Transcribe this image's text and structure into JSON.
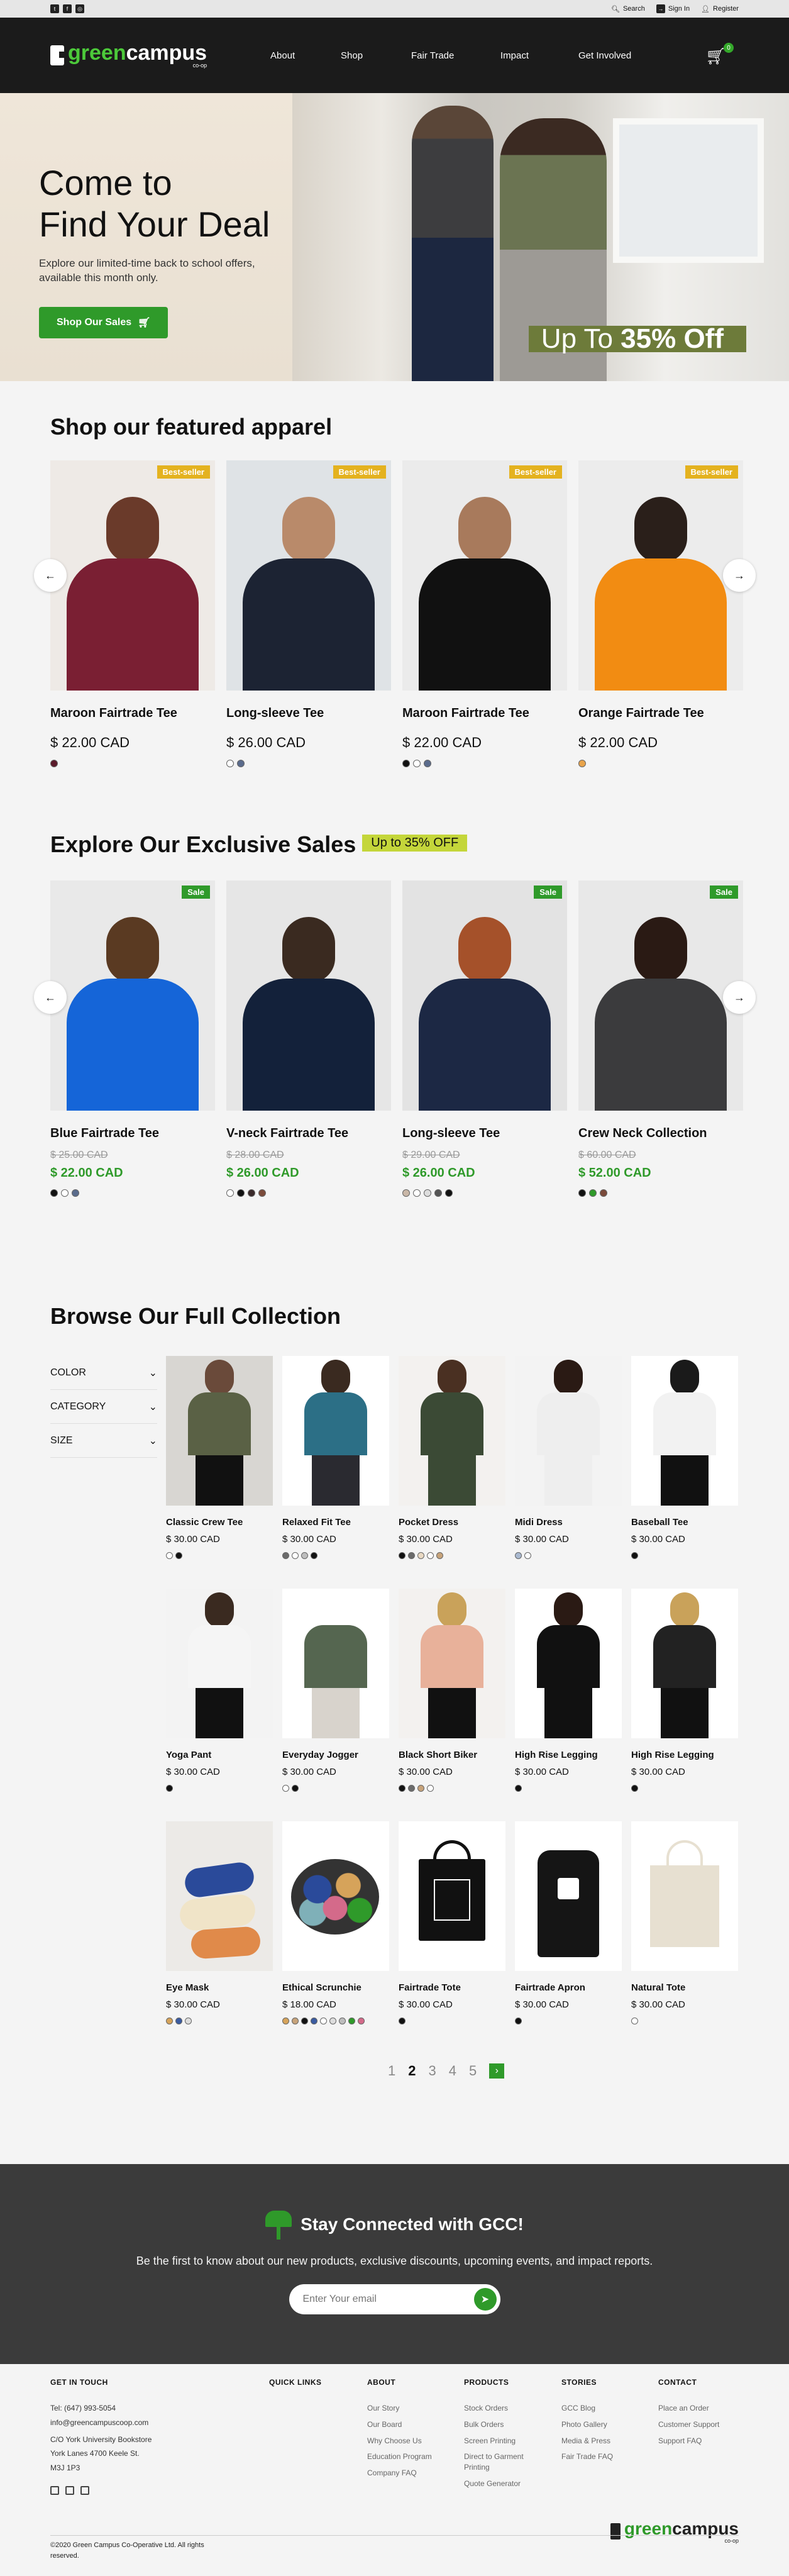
{
  "util": {
    "search": "Search",
    "signin": "Sign In",
    "register": "Register"
  },
  "brand": {
    "logo_green": "green",
    "logo_rest": "campus",
    "logo_sub": "co-op"
  },
  "nav": [
    "About",
    "Shop",
    "Fair Trade",
    "Impact",
    "Get Involved"
  ],
  "cart_count": "0",
  "hero": {
    "title_line1": "Come to",
    "title_line2": "Find Your Deal",
    "subtitle": "Explore our limited-time back to school offers, available this month only.",
    "button": "Shop Our Sales",
    "promo_prefix": "Up To ",
    "promo_value": "35% Off"
  },
  "featured": {
    "title": "Shop our featured apparel",
    "badge": "Best-seller",
    "items": [
      {
        "name": "Maroon Fairtrade Tee",
        "price": "$ 22.00 CAD",
        "swatches": [
          "#5b1a2a"
        ]
      },
      {
        "name": "Long-sleeve Tee",
        "price": "$ 26.00 CAD",
        "swatches": [
          "#ffffff",
          "#5a6b8c"
        ]
      },
      {
        "name": "Maroon Fairtrade Tee",
        "price": "$ 22.00 CAD",
        "swatches": [
          "#111111",
          "#ffffff",
          "#5a6b8c"
        ]
      },
      {
        "name": "Orange Fairtrade Tee",
        "price": "$ 22.00 CAD",
        "swatches": [
          "#e8a34a"
        ]
      }
    ]
  },
  "sales": {
    "title": "Explore Our Exclusive Sales",
    "tag": "Up to 35% OFF",
    "badge": "Sale",
    "items": [
      {
        "name": "Blue Fairtrade Tee",
        "old": "$ 25.00 CAD",
        "price": "$ 22.00 CAD",
        "swatches": [
          "#111111",
          "#ffffff",
          "#5a6b8c"
        ]
      },
      {
        "name": "V-neck Fairtrade Tee",
        "old": "$ 28.00 CAD",
        "price": "$ 26.00 CAD",
        "swatches": [
          "#ffffff",
          "#111111",
          "#3a2a2a",
          "#7a4a3a"
        ]
      },
      {
        "name": "Long-sleeve Tee",
        "old": "$ 29.00 CAD",
        "price": "$ 26.00 CAD",
        "swatches": [
          "#c9b7a7",
          "#ffffff",
          "#dddddd",
          "#555555",
          "#111111"
        ]
      },
      {
        "name": "Crew Neck Collection",
        "old": "$ 60.00 CAD",
        "price": "$ 52.00 CAD",
        "swatches": [
          "#111111",
          "#2f9a2a",
          "#7a4a3a"
        ]
      }
    ]
  },
  "collection": {
    "title": "Browse Our Full Collection",
    "filters": [
      "COLOR",
      "CATEGORY",
      "SIZE"
    ],
    "items": [
      {
        "name": "Classic Crew Tee",
        "price": "$ 30.00 CAD",
        "swatches": [
          "#ffffff",
          "#111111"
        ]
      },
      {
        "name": "Relaxed Fit Tee",
        "price": "$ 30.00 CAD",
        "swatches": [
          "#6b6b6b",
          "#ffffff",
          "#bdbdbd",
          "#111111"
        ]
      },
      {
        "name": "Pocket Dress",
        "price": "$ 30.00 CAD",
        "swatches": [
          "#111111",
          "#6b6b6b",
          "#e9d9c3",
          "#ffffff",
          "#c7a37a"
        ]
      },
      {
        "name": "Midi Dress",
        "price": "$ 30.00 CAD",
        "swatches": [
          "#a9b9d0",
          "#ffffff"
        ]
      },
      {
        "name": "Baseball Tee",
        "price": "$ 30.00 CAD",
        "swatches": [
          "#111111"
        ]
      },
      {
        "name": "Yoga Pant",
        "price": "$ 30.00 CAD",
        "swatches": [
          "#111111"
        ]
      },
      {
        "name": "Everyday Jogger",
        "price": "$ 30.00 CAD",
        "swatches": [
          "#ffffff",
          "#111111"
        ]
      },
      {
        "name": "Black Short Biker",
        "price": "$ 30.00 CAD",
        "swatches": [
          "#111111",
          "#6b6b6b",
          "#c7a37a",
          "#ffffff"
        ]
      },
      {
        "name": "High Rise Legging",
        "price": "$ 30.00 CAD",
        "swatches": [
          "#111111"
        ]
      },
      {
        "name": "High Rise Legging",
        "price": "$ 30.00 CAD",
        "swatches": [
          "#111111"
        ]
      },
      {
        "name": "Eye Mask",
        "price": "$ 30.00 CAD",
        "swatches": [
          "#d6a35a",
          "#3a5ba0",
          "#dddddd"
        ]
      },
      {
        "name": "Ethical Scrunchie",
        "price": "$ 18.00 CAD",
        "swatches": [
          "#d6a35a",
          "#c7a37a",
          "#111111",
          "#3a5ba0",
          "#ffffff",
          "#dddddd",
          "#bdbdbd",
          "#2f9a2a",
          "#d46a8a"
        ]
      },
      {
        "name": "Fairtrade Tote",
        "price": "$ 30.00 CAD",
        "swatches": [
          "#111111"
        ]
      },
      {
        "name": "Fairtrade Apron",
        "price": "$ 30.00 CAD",
        "swatches": [
          "#111111"
        ]
      },
      {
        "name": "Natural Tote",
        "price": "$ 30.00 CAD",
        "swatches": [
          "#ffffff"
        ]
      }
    ],
    "pages": [
      "1",
      "2",
      "3",
      "4",
      "5"
    ],
    "current_page": "2"
  },
  "newsletter": {
    "title": "Stay Connected with GCC!",
    "text": "Be the first to know about our new products, exclusive discounts, upcoming events, and impact reports.",
    "placeholder": "Enter Your email"
  },
  "footer": {
    "get_in_touch": {
      "heading": "GET IN TOUCH",
      "tel": "Tel: (647) 993-5054",
      "email": "info@greencampuscoop.com",
      "addr1": "C/O York University Bookstore",
      "addr2": "York Lanes 4700 Keele St.",
      "addr3": "M3J 1P3"
    },
    "quick_links": {
      "heading": "QUICK LINKS"
    },
    "about": {
      "heading": "ABOUT",
      "items": [
        "Our Story",
        "Our Board",
        "Why Choose Us",
        "Education Program",
        "Company FAQ"
      ]
    },
    "products": {
      "heading": "PRODUCTS",
      "items": [
        "Stock Orders",
        "Bulk Orders",
        "Screen Printing",
        "Direct to Garment Printing",
        "Quote Generator"
      ]
    },
    "stories": {
      "heading": "STORIES",
      "items": [
        "GCC Blog",
        "Photo Gallery",
        "Media & Press",
        "Fair Trade FAQ"
      ]
    },
    "contact": {
      "heading": "CONTACT",
      "items": [
        "Place an Order",
        "Customer Support",
        "Support FAQ"
      ]
    },
    "copyright": "©2020 Green Campus Co-Operative Ltd. All rights reserved."
  }
}
